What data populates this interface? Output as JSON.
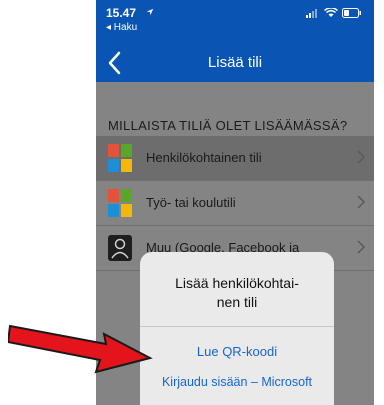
{
  "status_bar": {
    "time": "15.47",
    "back_app": "◂ Haku"
  },
  "nav": {
    "title": "Lisää tili"
  },
  "section_header": "MILLAISTA TILIÄ OLET LISÄÄMÄSSÄ?",
  "list_items": [
    {
      "label": "Henkilökohtainen tili",
      "icon": "microsoft-logo-icon"
    },
    {
      "label": "Työ- tai koulutili",
      "icon": "microsoft-logo-icon"
    },
    {
      "label": "Muu (Google, Facebook ja",
      "icon": "person-icon"
    }
  ],
  "sheet": {
    "title_line1": "Lisää henkilökohtai-",
    "title_line2": "nen tili",
    "action_qr": "Lue QR-koodi",
    "action_signin": "Kirjaudu sisään – Microsoft"
  },
  "colors": {
    "nav_blue": "#0a55b4",
    "link_blue": "#1466d6",
    "arrow_red": "#e3141b",
    "ms_red": "#e2533a",
    "ms_green": "#5aa629",
    "ms_blue": "#1e8fd6",
    "ms_yellow": "#f5b60a"
  }
}
